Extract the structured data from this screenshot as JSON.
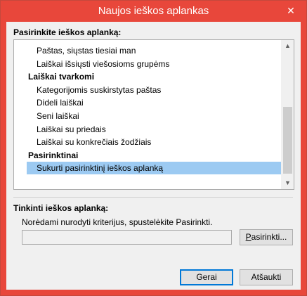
{
  "window": {
    "title": "Naujos ieškos aplankas",
    "close_glyph": "✕"
  },
  "select_label": "Pasirinkite ieškos aplanką:",
  "list": {
    "rows": [
      {
        "text": "Paštas, siųstas tiesiai man",
        "kind": "item"
      },
      {
        "text": "Laiškai išsiųsti viešosioms grupėms",
        "kind": "item"
      },
      {
        "text": "Laiškai tvarkomi",
        "kind": "group"
      },
      {
        "text": "Kategorijomis suskirstytas paštas",
        "kind": "item"
      },
      {
        "text": "Dideli laiškai",
        "kind": "item"
      },
      {
        "text": "Seni laiškai",
        "kind": "item"
      },
      {
        "text": "Laiškai su priedais",
        "kind": "item"
      },
      {
        "text": "Laiškai su konkrečiais žodžiais",
        "kind": "item"
      },
      {
        "text": "Pasirinktinai",
        "kind": "group"
      },
      {
        "text": "Sukurti pasirinktinį ieškos aplanką",
        "kind": "selected"
      }
    ],
    "scroll_up": "▲",
    "scroll_down": "▼"
  },
  "customize_label": "Tinkinti ieškos aplanką:",
  "hint_text": "Norėdami nurodyti kriterijus, spustelėkite Pasirinkti.",
  "criteria_value": "",
  "choose_button": {
    "accel": "P",
    "rest": "asirinkti..."
  },
  "ok_button": "Gerai",
  "cancel_button": "Atšaukti"
}
